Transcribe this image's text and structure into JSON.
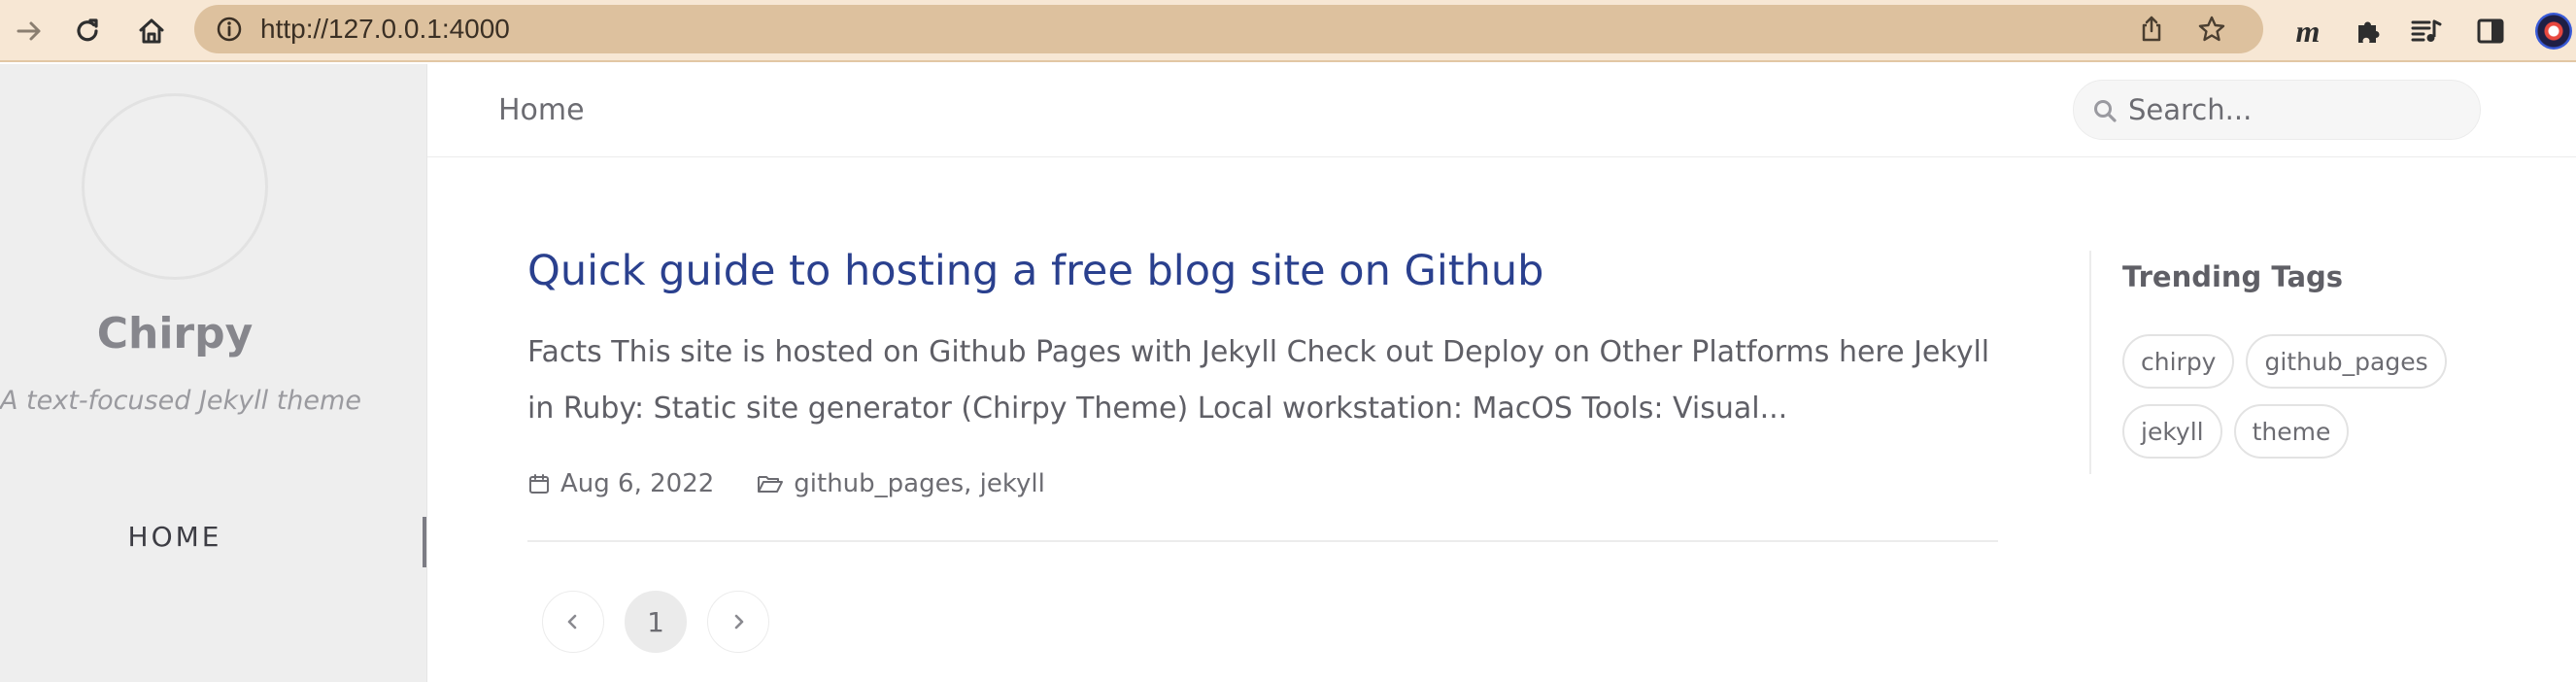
{
  "browser": {
    "url": "http://127.0.0.1:4000",
    "extension_m_label": "m",
    "icons": [
      "forward-arrow-icon",
      "reload-icon",
      "home-icon",
      "site-info-icon",
      "share-icon",
      "bookmark-star-icon",
      "extensions-puzzle-icon",
      "media-control-icon",
      "side-panel-icon",
      "profile-avatar"
    ]
  },
  "sidebar": {
    "title": "Chirpy",
    "subtitle": "A text-focused Jekyll theme",
    "nav": [
      {
        "label": "HOME",
        "active": true
      }
    ]
  },
  "topbar": {
    "breadcrumb": "Home",
    "search_placeholder": "Search..."
  },
  "posts": [
    {
      "title": "Quick guide to hosting a free blog site on Github",
      "excerpt": "Facts This site is hosted on Github Pages with Jekyll Check out Deploy on Other Platforms here Jekyll in Ruby: Static site generator (Chirpy Theme) Local workstation: MacOS Tools: Visual...",
      "date": "Aug 6, 2022",
      "categories": "github_pages, jekyll"
    }
  ],
  "pagination": {
    "current": "1",
    "prev_icon": "chevron-left-icon",
    "next_icon": "chevron-right-icon"
  },
  "trending": {
    "heading": "Trending Tags",
    "tags": [
      "chirpy",
      "github_pages",
      "jekyll",
      "theme"
    ]
  },
  "colors": {
    "toolbar_bg": "#f7e7d4",
    "urlbar_bg": "#ddc19e",
    "sidebar_bg": "#eeeeee",
    "post_title": "#2a408e"
  }
}
